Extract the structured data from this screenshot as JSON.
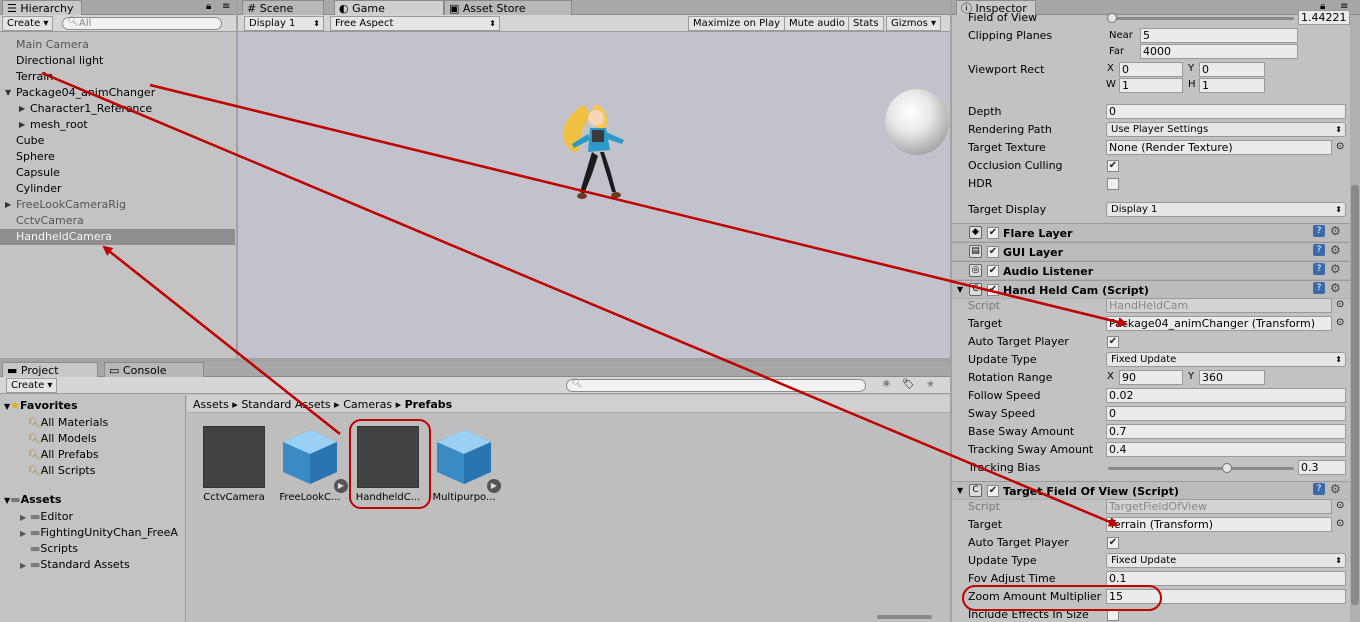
{
  "hierarchy": {
    "tab": "Hierarchy",
    "create": "Create",
    "search_placeholder": "All",
    "items": [
      "Main Camera",
      "Directional light",
      "Terrain",
      "Package04_animChanger",
      "Character1_Reference",
      "mesh_root",
      "Cube",
      "Sphere",
      "Capsule",
      "Cylinder",
      "FreeLookCameraRig",
      "CctvCamera",
      "HandheldCamera"
    ]
  },
  "center": {
    "tabs": [
      "Scene",
      "Game",
      "Asset Store"
    ],
    "display": "Display 1",
    "aspect": "Free Aspect",
    "maximize": "Maximize on Play",
    "mute": "Mute audio",
    "stats": "Stats",
    "gizmos": "Gizmos"
  },
  "project": {
    "tabs": [
      "Project",
      "Console"
    ],
    "create": "Create",
    "favorites_title": "Favorites",
    "favorites": [
      "All Materials",
      "All Models",
      "All Prefabs",
      "All Scripts"
    ],
    "assets_title": "Assets",
    "assets": [
      "Editor",
      "FightingUnityChan_FreeA",
      "Scripts",
      "Standard Assets"
    ],
    "breadcrumb": [
      "Assets",
      "Standard Assets",
      "Cameras",
      "Prefabs"
    ],
    "thumbs": [
      "CctvCamera",
      "FreeLookC...",
      "HandheldC...",
      "Multipurpo..."
    ]
  },
  "inspector": {
    "tab": "Inspector",
    "fov_label": "Field of View",
    "fov_value": "1.44221",
    "clipping_label": "Clipping Planes",
    "near_label": "Near",
    "near": "5",
    "far_label": "Far",
    "far": "4000",
    "viewport_label": "Viewport Rect",
    "x_label": "X",
    "x": "0",
    "y_label": "Y",
    "y": "0",
    "w_label": "W",
    "w": "1",
    "h_label": "H",
    "h": "1",
    "depth_label": "Depth",
    "depth": "0",
    "rpath_label": "Rendering Path",
    "rpath": "Use Player Settings",
    "ttex_label": "Target Texture",
    "ttex": "None (Render Texture)",
    "occl_label": "Occlusion Culling",
    "hdr_label": "HDR",
    "tdisp_label": "Target Display",
    "tdisp": "Display 1",
    "flare": "Flare Layer",
    "gui": "GUI Layer",
    "audio": "Audio Listener",
    "hhc": {
      "title": "Hand Held Cam (Script)",
      "script_label": "Script",
      "script": "HandHeldCam",
      "target_label": "Target",
      "target": "Package04_animChanger (Transform)",
      "auto_label": "Auto Target Player",
      "update_label": "Update Type",
      "update": "Fixed Update",
      "rot_label": "Rotation Range",
      "rot_x_label": "X",
      "rot_x": "90",
      "rot_y_label": "Y",
      "rot_y": "360",
      "follow_label": "Follow Speed",
      "follow": "0.02",
      "sway_label": "Sway Speed",
      "sway": "0",
      "bsway_label": "Base Sway Amount",
      "bsway": "0.7",
      "tsway_label": "Tracking Sway Amount",
      "tsway": "0.4",
      "tbias_label": "Tracking Bias",
      "tbias": "0.3"
    },
    "tfov": {
      "title": "Target Field Of View (Script)",
      "script_label": "Script",
      "script": "TargetFieldOfView",
      "target_label": "Target",
      "target": "Terrain (Transform)",
      "auto_label": "Auto Target Player",
      "update_label": "Update Type",
      "update": "Fixed Update",
      "fovadj_label": "Fov Adjust Time",
      "fovadj": "0.1",
      "zoom_label": "Zoom Amount Multiplier",
      "zoom": "15",
      "incl_label": "Include Effects In Size"
    }
  },
  "colors": {
    "arrow": "#c00000",
    "highlight": "#c00000",
    "sky": "#c2c2cc"
  }
}
